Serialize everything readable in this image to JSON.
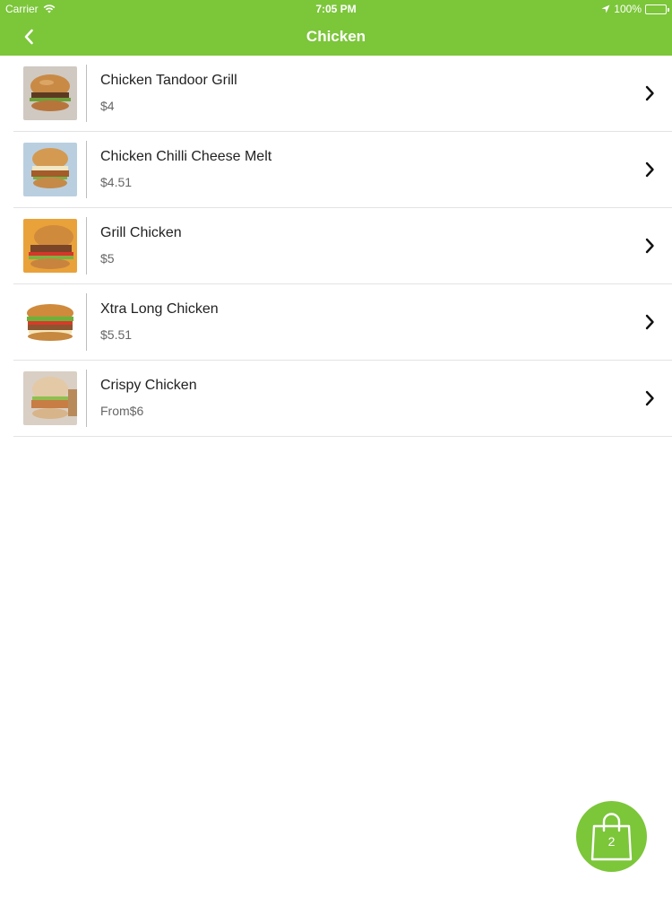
{
  "status_bar": {
    "carrier": "Carrier",
    "time": "7:05 PM",
    "battery": "100%"
  },
  "nav": {
    "title": "Chicken",
    "back_icon": "chevron-left-icon"
  },
  "theme": {
    "accent": "#7cc63a"
  },
  "products": [
    {
      "name": "Chicken Tandoor Grill",
      "price": "$4"
    },
    {
      "name": "Chicken Chilli Cheese Melt",
      "price": "$4.51"
    },
    {
      "name": "Grill Chicken",
      "price": "$5"
    },
    {
      "name": "Xtra Long Chicken",
      "price": "$5.51"
    },
    {
      "name": "Crispy Chicken",
      "price": "From$6"
    }
  ],
  "cart": {
    "count": "2",
    "icon": "shopping-bag-icon"
  }
}
